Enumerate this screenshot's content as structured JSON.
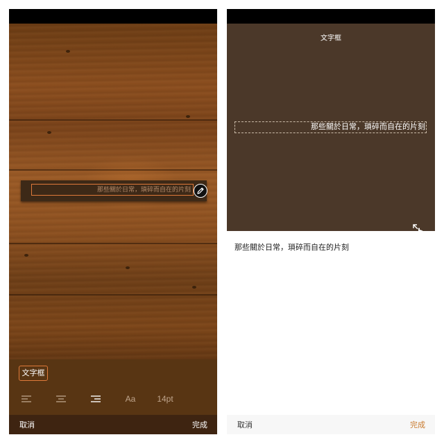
{
  "left_screen": {
    "label_text": "那些關於日常，瑣碎而自在的片刻",
    "toolbar": {
      "style_tag": "文字框",
      "align_left_icon": "align-left-icon",
      "align_center_icon": "align-center-icon",
      "align_right_icon": "align-right-icon",
      "font_label": "Aa",
      "size_label": "14pt"
    },
    "bottom": {
      "cancel": "取消",
      "done": "完成"
    }
  },
  "right_screen": {
    "title": "文字框",
    "preview_text": "那些關於日常，瑣碎而自在的片刻",
    "input_text": "那些關於日常，瑣碎而自在的片刻",
    "bottom": {
      "cancel": "取消",
      "done": "完成"
    }
  },
  "colors": {
    "accent": "#e07a3a",
    "done_accent": "#c97a2e",
    "preview_bg": "#4b3829",
    "toolbar_bg": "#583513"
  }
}
